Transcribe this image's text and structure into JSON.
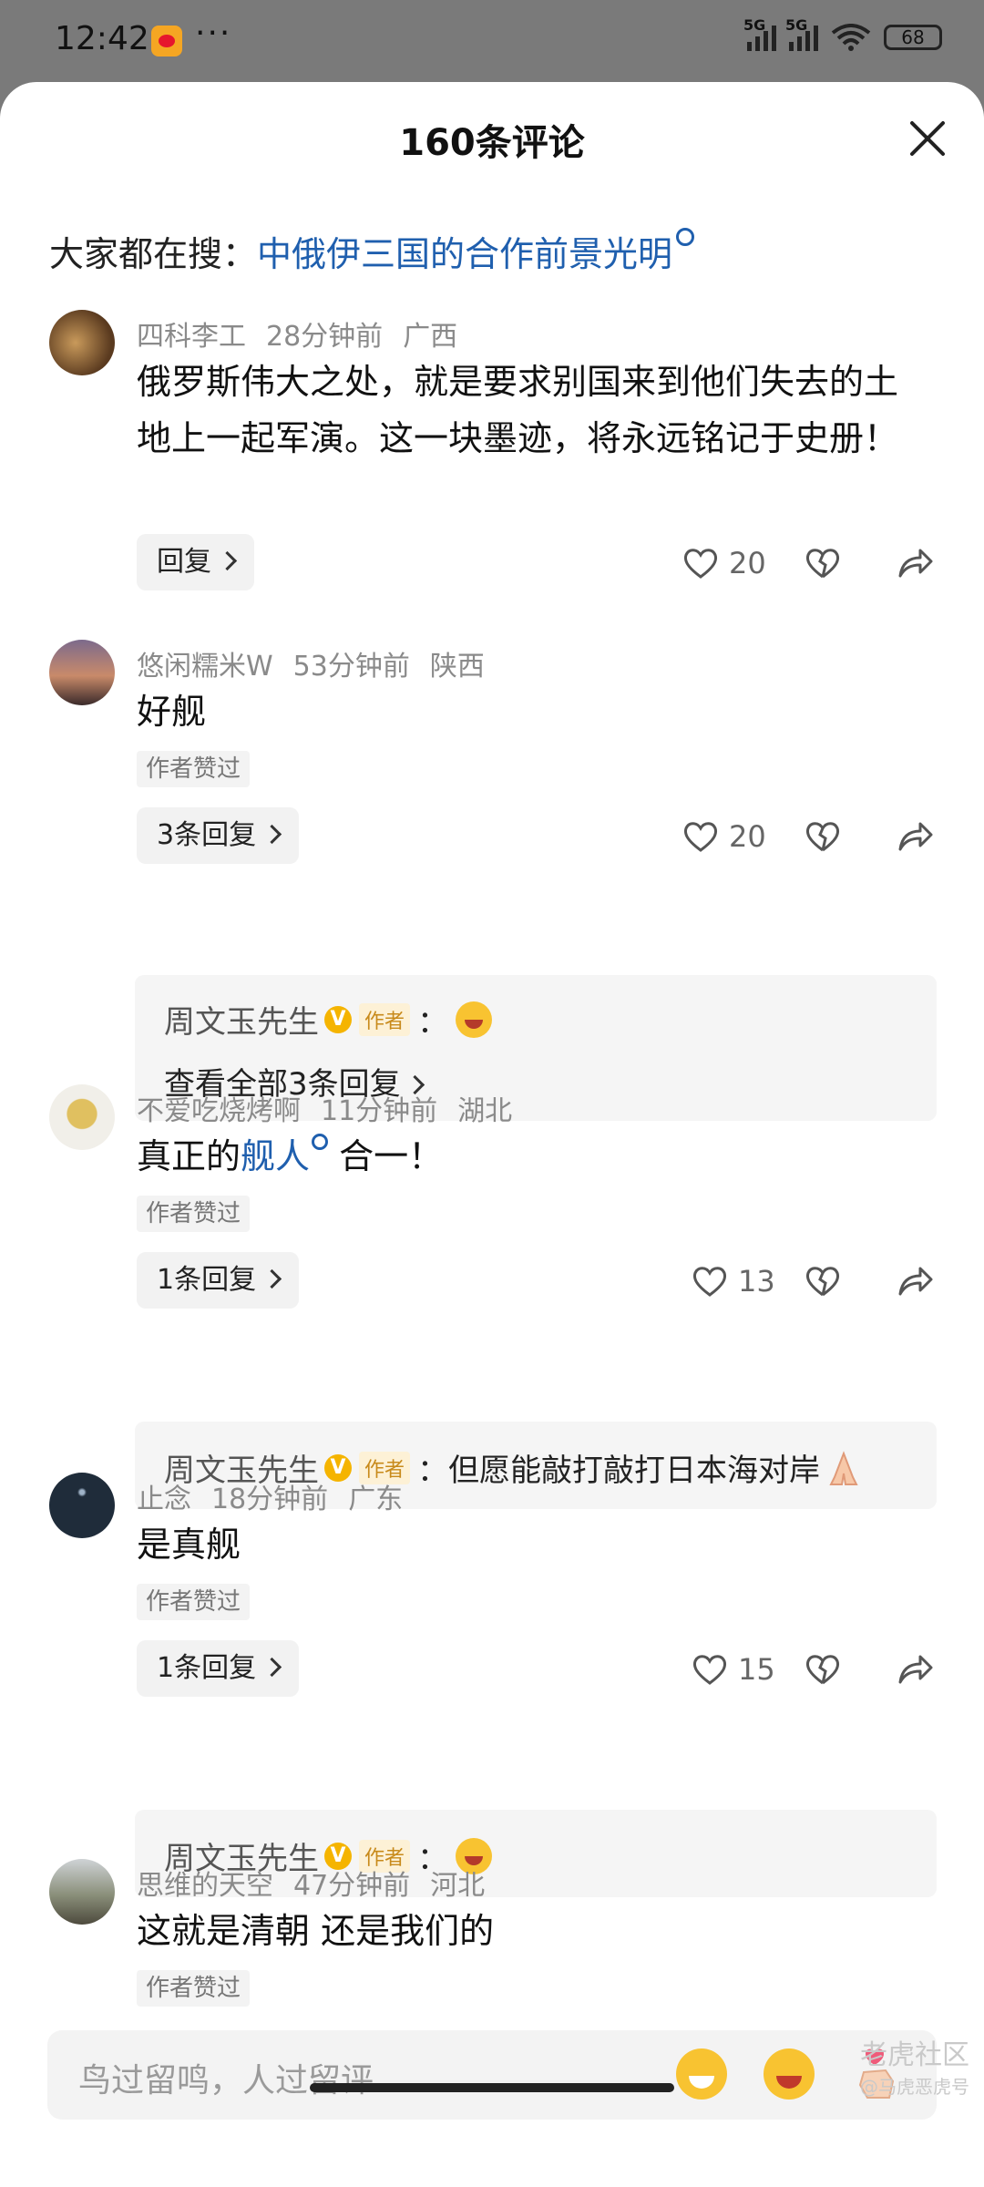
{
  "status_bar": {
    "time": "12:42",
    "dots": "···",
    "network1": "5G",
    "network2": "5G",
    "battery": "68"
  },
  "sheet": {
    "title": "160条评论"
  },
  "hot_search": {
    "label": "大家都在搜：",
    "link": "中俄伊三国的合作前景光明"
  },
  "comments": [
    {
      "user": "四科李工",
      "time": "28分钟前",
      "location": "广西",
      "text": "俄罗斯伟大之处，就是要求别国来到他们失去的土地上一起军演。这一块墨迹，将永远铭记于史册！",
      "reply_label": "回复",
      "likes": "20"
    },
    {
      "user": "悠闲糯米W",
      "time": "53分钟前",
      "location": "陕西",
      "text": "好舰",
      "author_liked": "作者赞过",
      "reply_label": "3条回复",
      "likes": "20",
      "reply_preview": {
        "name": "周文玉先生",
        "tag": "作者",
        "colon": "：",
        "text": "",
        "view_all": "查看全部3条回复"
      }
    },
    {
      "user": "不爱吃烧烤啊",
      "time": "11分钟前",
      "location": "湖北",
      "text_pre": "真正的",
      "text_link": "舰人",
      "text_post": " 合一！",
      "author_liked": "作者赞过",
      "reply_label": "1条回复",
      "likes": "13",
      "reply_preview": {
        "name": "周文玉先生",
        "tag": "作者",
        "colon": "：",
        "text": "但愿能敲打敲打日本海对岸"
      }
    },
    {
      "user": "止念",
      "time": "18分钟前",
      "location": "广东",
      "text": "是真舰",
      "author_liked": "作者赞过",
      "reply_label": "1条回复",
      "likes": "15",
      "reply_preview": {
        "name": "周文玉先生",
        "tag": "作者",
        "colon": "：",
        "text": ""
      }
    },
    {
      "user": "思维的天空",
      "time": "47分钟前",
      "location": "河北",
      "text": "这就是清朝 还是我们的",
      "author_liked": "作者赞过"
    }
  ],
  "input": {
    "placeholder": "鸟过留鸣，人过留评"
  },
  "watermark": {
    "main": "老虎社区",
    "sub": "@马虎恶虎号"
  },
  "colors": {
    "link": "#1f5fae",
    "author_tag_bg": "#fdf1d6",
    "author_tag_text": "#c88a1b",
    "verified": "#f5b400"
  }
}
